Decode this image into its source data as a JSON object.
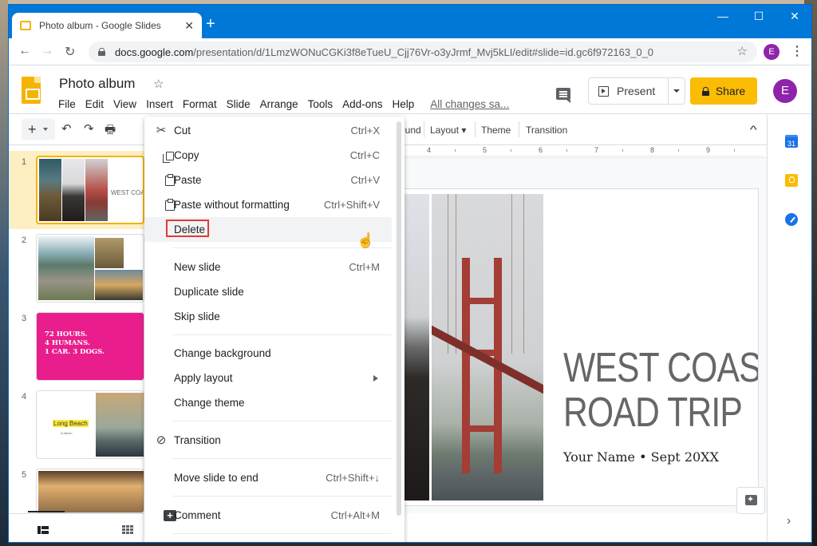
{
  "browser": {
    "tab_title": "Photo album - Google Slides",
    "tab_close": "✕",
    "new_tab": "+",
    "url_host": "docs.google.com",
    "url_path": "/presentation/d/1LmzWONuCGKi3f8eTueU_Cjj76Vr-o3yJrmf_Mvj5kLI/edit#slide=id.gc6f972163_0_0",
    "profile_initial": "E",
    "window_controls": {
      "minimize": "—",
      "maximize": "☐",
      "close": "✕"
    },
    "nav": {
      "back": "←",
      "forward": "→",
      "reload": "↻",
      "star": "☆",
      "menu": "⋮"
    }
  },
  "header": {
    "doc_title": "Photo album",
    "star": "☆",
    "menu": [
      "File",
      "Edit",
      "View",
      "Insert",
      "Format",
      "Slide",
      "Arrange",
      "Tools",
      "Add-ons",
      "Help"
    ],
    "save_status": "All changes sa...",
    "present_label": "Present",
    "share_label": "Share",
    "account_initial": "E"
  },
  "toolbar": {
    "new_slide": "+",
    "undo": "↶",
    "redo": "↷",
    "print": "🖶",
    "background_partial": "ound",
    "layout": "Layout ▾",
    "theme": "Theme",
    "transition": "Transition",
    "collapse": "^"
  },
  "ruler": {
    "marks": [
      "4",
      "5",
      "6",
      "7",
      "8",
      "9"
    ]
  },
  "filmstrip": {
    "slides": [
      {
        "number": "1",
        "title": "WEST COAST ROAD TRIP",
        "subtitle": "Your Name • Sept 20XX",
        "selected": true
      },
      {
        "number": "2",
        "selected": false
      },
      {
        "number": "3",
        "lines": [
          "72 HOURS.",
          "4 HUMANS.",
          "1 CAR. 3 DOGS."
        ],
        "selected": false
      },
      {
        "number": "4",
        "title": "Long Beach",
        "subtitle": "A album",
        "selected": false
      },
      {
        "number": "5",
        "selected": false
      }
    ]
  },
  "slide": {
    "title_line1": "WEST COAST",
    "title_line2": "ROAD TRIP",
    "subtitle": "Your Name • Sept 20XX"
  },
  "context_menu": {
    "items": [
      {
        "label": "Cut",
        "shortcut": "Ctrl+X",
        "icon": "scissors-icon"
      },
      {
        "label": "Copy",
        "shortcut": "Ctrl+C",
        "icon": "copy-icon"
      },
      {
        "label": "Paste",
        "shortcut": "Ctrl+V",
        "icon": "paste-icon"
      },
      {
        "label": "Paste without formatting",
        "shortcut": "Ctrl+Shift+V",
        "icon": "paste-plain-icon"
      },
      {
        "label": "Delete",
        "shortcut": "",
        "icon": "",
        "highlighted": true
      },
      {
        "label": "New slide",
        "shortcut": "Ctrl+M"
      },
      {
        "label": "Duplicate slide",
        "shortcut": ""
      },
      {
        "label": "Skip slide",
        "shortcut": ""
      },
      {
        "label": "Change background",
        "shortcut": ""
      },
      {
        "label": "Apply layout",
        "shortcut": "",
        "submenu": true
      },
      {
        "label": "Change theme",
        "shortcut": ""
      },
      {
        "label": "Transition",
        "shortcut": "",
        "icon": "transition-icon"
      },
      {
        "label": "Move slide to end",
        "shortcut": "Ctrl+Shift+↓"
      },
      {
        "label": "Comment",
        "shortcut": "Ctrl+Alt+M",
        "icon": "comment-icon"
      }
    ]
  },
  "side_panel": {
    "calendar_day": "31",
    "expand": "›"
  },
  "colors": {
    "accent": "#f4b400",
    "share": "#fbbc04",
    "avatar": "#8e24aa",
    "chrome_blue": "#0078d7",
    "highlight_box": "#e53935",
    "slide3_bg": "#e91e8c"
  }
}
